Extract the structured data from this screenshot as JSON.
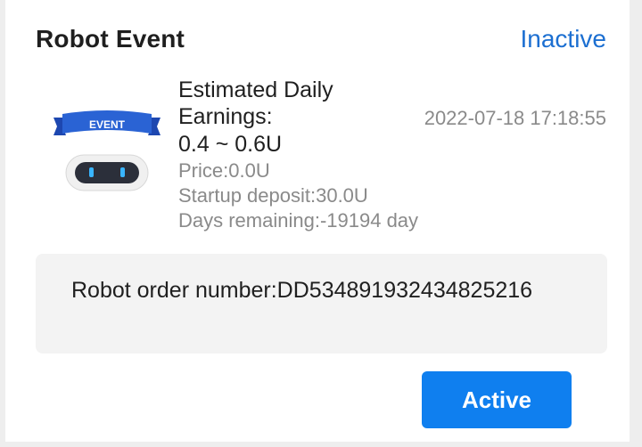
{
  "header": {
    "title": "Robot Event",
    "status": "Inactive"
  },
  "robot": {
    "badge_text": "EVENT",
    "earnings_label": "Estimated Daily Earnings:",
    "earnings_range": "0.4 ~ 0.6U",
    "price": "Price:0.0U",
    "startup_deposit": "Startup deposit:30.0U",
    "days_remaining": "Days remaining:-19194 day",
    "timestamp": "2022-07-18 17:18:55"
  },
  "order": {
    "text": "Robot order number:DD534891932434825216"
  },
  "actions": {
    "active_label": "Active"
  },
  "colors": {
    "status": "#1c6fd1",
    "button": "#0f7fef",
    "badge": "#2458c6"
  }
}
